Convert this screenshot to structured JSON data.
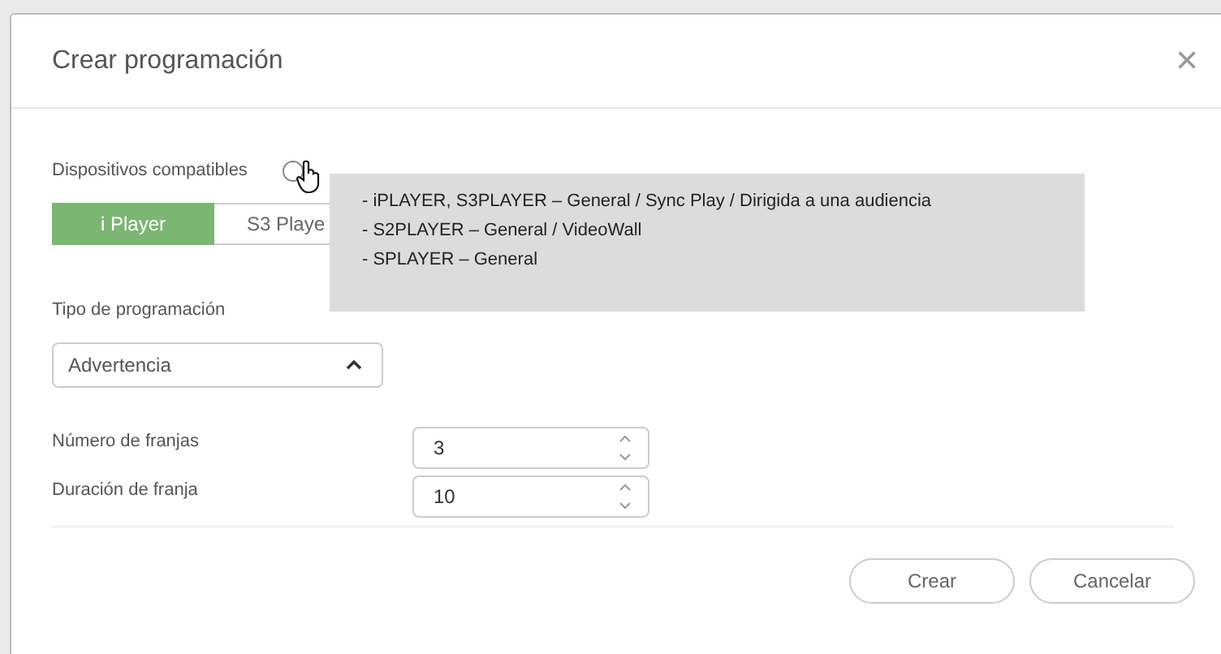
{
  "dialog": {
    "title": "Crear programación",
    "close": "×"
  },
  "devices": {
    "label": "Dispositivos compatibles",
    "tabs": [
      {
        "label": "i Player",
        "selected": true
      },
      {
        "label": "S3 Playe",
        "selected": false
      }
    ],
    "tooltip": [
      "- iPLAYER, S3PLAYER – General / Sync Play / Dirigida a una audiencia",
      "- S2PLAYER – General / VideoWall",
      "- SPLAYER – General"
    ]
  },
  "schedule_type": {
    "label": "Tipo de programación",
    "value": "Advertencia",
    "expanded": true
  },
  "fields": [
    {
      "label": "Número de franjas",
      "value": "3"
    },
    {
      "label": "Duración de franja",
      "value": "10"
    }
  ],
  "buttons": [
    "Crear",
    "Cancelar"
  ]
}
